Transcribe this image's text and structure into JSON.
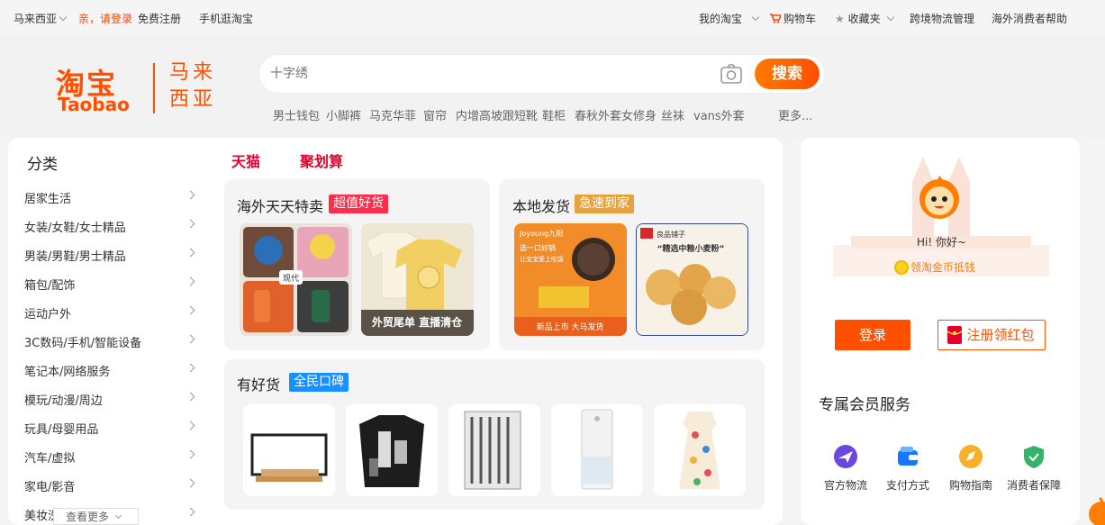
{
  "topbar": {
    "region": "马来西亚",
    "login_prompt": "亲，请登录",
    "register": "免费注册",
    "mobile": "手机逛淘宝",
    "my_taobao": "我的淘宝",
    "cart": "购物车",
    "favorites": "收藏夹",
    "logistics": "跨境物流管理",
    "help": "海外消费者帮助"
  },
  "logo": {
    "cn": "淘宝",
    "en": "Taobao",
    "region_line1": "马来",
    "region_line2": "西亚"
  },
  "search": {
    "placeholder": "十字绣",
    "button": "搜索"
  },
  "hot_words": [
    "男士钱包",
    "小脚裤",
    "马克华菲",
    "窗帘",
    "内增高坡跟短靴",
    "鞋柜",
    "春秋外套女修身",
    "丝袜",
    "vans外套",
    "更多..."
  ],
  "categories": {
    "title": "分类",
    "items": [
      "居家生活",
      "女装/女鞋/女士精品",
      "男装/男鞋/男士精品",
      "箱包/配饰",
      "运动户外",
      "3C数码/手机/智能设备",
      "笔记本/网络服务",
      "模玩/动漫/周边",
      "玩具/母婴用品",
      "汽车/虚拟",
      "家电/影音",
      "美妆洗护"
    ],
    "more": "查看更多"
  },
  "tabs": [
    "天猫",
    "聚划算"
  ],
  "panels": {
    "overseas": {
      "title": "海外天天特卖",
      "badge": "超值好货",
      "img2_caption": "外贸尾单 直播清仓",
      "img1_tag": "现代"
    },
    "local": {
      "title": "本地发货",
      "badge": "急速到家",
      "img1_brand": "Joyoung九阳",
      "img1_line1": "选一口好锅",
      "img1_line2": "让宝宝爱上吃饭",
      "img1_footer": "新品上市 大马发货",
      "img2_brand": "良品铺子",
      "img2_text": "“精选中粮小麦粉”"
    },
    "good": {
      "title": "有好货",
      "badge": "全民口碑"
    }
  },
  "user": {
    "greeting": "Hi! 你好~",
    "coin_text": "领淘金币抵钱",
    "login": "登录",
    "register_red": "注册领红包",
    "services_title": "专属会员服务",
    "services": [
      "官方物流",
      "支付方式",
      "购物指南",
      "消费者保障"
    ]
  },
  "colors": {
    "brand": "#ff5000",
    "tmall_red": "#e4002b",
    "badge_red": "#ff2d4a",
    "badge_gold": "#e6a23c",
    "badge_blue": "#1890ff"
  }
}
